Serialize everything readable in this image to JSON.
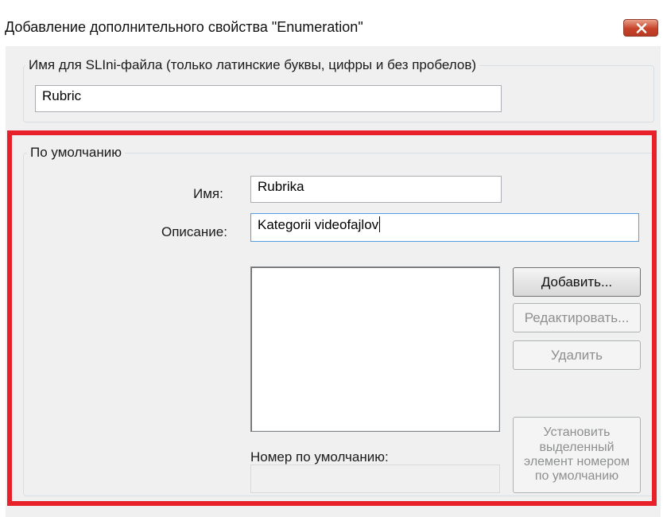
{
  "window": {
    "title": "Добавление дополнительного свойства \"Enumeration\"",
    "close_icon": "close-x-icon"
  },
  "ini_group": {
    "label": "Имя для SLIni-файла (только латинские буквы, цифры и без пробелов)",
    "value": "Rubric"
  },
  "default_group": {
    "label": "По умолчанию",
    "name_label": "Имя:",
    "name_value": "Rubrika",
    "description_label": "Описание:",
    "description_value": "Kategorii videofajlov",
    "default_number_label": "Номер по умолчанию:",
    "default_number_value": ""
  },
  "buttons": {
    "add": "Добавить...",
    "edit": "Редактировать...",
    "delete": "Удалить",
    "set_default": "Установить выделенный элемент номером по умолчанию"
  },
  "colors": {
    "highlight_frame": "#e8202a",
    "close_button": "#c7432a"
  }
}
